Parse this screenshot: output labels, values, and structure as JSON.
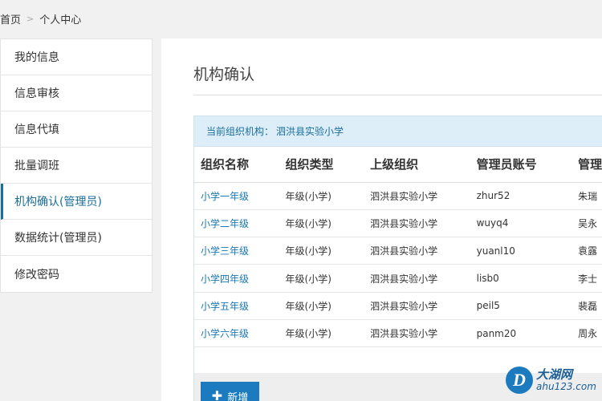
{
  "breadcrumb": {
    "home": "首页",
    "separator": ">",
    "current": "个人中心"
  },
  "sidebar": {
    "items": [
      {
        "label": "我的信息"
      },
      {
        "label": "信息审核"
      },
      {
        "label": "信息代填"
      },
      {
        "label": "批量调班"
      },
      {
        "label": "机构确认(管理员)",
        "active": true
      },
      {
        "label": "数据统计(管理员)"
      },
      {
        "label": "修改密码"
      }
    ]
  },
  "main": {
    "title": "机构确认",
    "current_org_label": "当前组织机构：",
    "current_org_name": "泗洪县实验小学",
    "table": {
      "headers": [
        "组织名称",
        "组织类型",
        "上级组织",
        "管理员账号",
        "管理"
      ],
      "rows": [
        [
          "小学一年级",
          "年级(小学)",
          "泗洪县实验小学",
          "zhur52",
          "朱瑞"
        ],
        [
          "小学二年级",
          "年级(小学)",
          "泗洪县实验小学",
          "wuyq4",
          "吴永"
        ],
        [
          "小学三年级",
          "年级(小学)",
          "泗洪县实验小学",
          "yuanl10",
          "袁露"
        ],
        [
          "小学四年级",
          "年级(小学)",
          "泗洪县实验小学",
          "lisb0",
          "李士"
        ],
        [
          "小学五年级",
          "年级(小学)",
          "泗洪县实验小学",
          "peil5",
          "裴磊"
        ],
        [
          "小学六年级",
          "年级(小学)",
          "泗洪县实验小学",
          "panm20",
          "周永"
        ]
      ]
    },
    "add_button": {
      "icon": "plus-icon",
      "label": "新增"
    }
  },
  "watermark": {
    "logo_letter": "D",
    "name": "大湖网",
    "url": "ahu123.com"
  },
  "colors": {
    "accent": "#1c7bbf",
    "link": "#1a78b4",
    "header_bg": "#ddeef8"
  }
}
